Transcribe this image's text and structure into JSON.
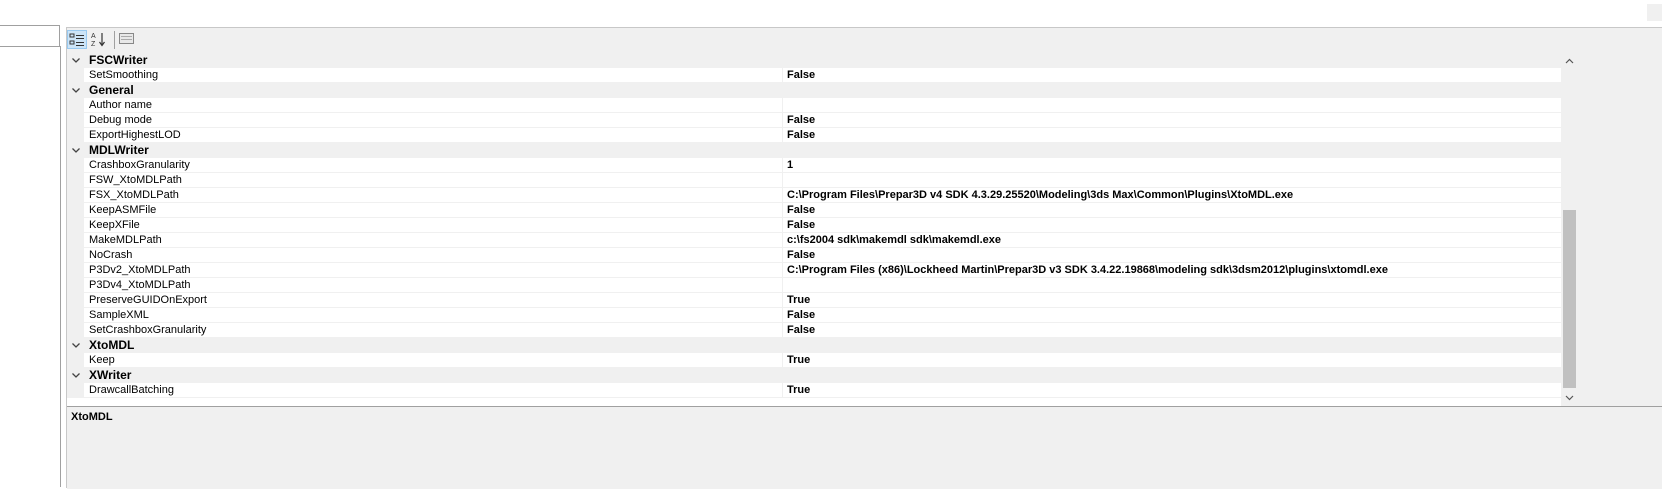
{
  "toolbar": {
    "categorized_tooltip": "Categorized",
    "alphabetical_tooltip": "Alphabetical",
    "property_pages_tooltip": "Property Pages"
  },
  "categories": [
    {
      "name": "FSCWriter",
      "properties": [
        {
          "name": "SetSmoothing",
          "value": "False"
        }
      ]
    },
    {
      "name": "General",
      "properties": [
        {
          "name": "Author name",
          "value": ""
        },
        {
          "name": "Debug mode",
          "value": "False"
        },
        {
          "name": "ExportHighestLOD",
          "value": "False"
        }
      ]
    },
    {
      "name": "MDLWriter",
      "properties": [
        {
          "name": "CrashboxGranularity",
          "value": "1"
        },
        {
          "name": "FSW_XtoMDLPath",
          "value": ""
        },
        {
          "name": "FSX_XtoMDLPath",
          "value": "C:\\Program Files\\Prepar3D v4 SDK 4.3.29.25520\\Modeling\\3ds Max\\Common\\Plugins\\XtoMDL.exe"
        },
        {
          "name": "KeepASMFile",
          "value": "False"
        },
        {
          "name": "KeepXFile",
          "value": "False"
        },
        {
          "name": "MakeMDLPath",
          "value": "c:\\fs2004 sdk\\makemdl sdk\\makemdl.exe"
        },
        {
          "name": "NoCrash",
          "value": "False"
        },
        {
          "name": "P3Dv2_XtoMDLPath",
          "value": "C:\\Program Files (x86)\\Lockheed Martin\\Prepar3D v3 SDK 3.4.22.19868\\modeling sdk\\3dsm2012\\plugins\\xtomdl.exe"
        },
        {
          "name": "P3Dv4_XtoMDLPath",
          "value": ""
        },
        {
          "name": "PreserveGUIDOnExport",
          "value": "True"
        },
        {
          "name": "SampleXML",
          "value": "False"
        },
        {
          "name": "SetCrashboxGranularity",
          "value": "False"
        }
      ]
    },
    {
      "name": "XtoMDL",
      "properties": [
        {
          "name": "Keep",
          "value": "True"
        }
      ]
    },
    {
      "name": "XWriter",
      "properties": [
        {
          "name": "DrawcallBatching",
          "value": "True"
        }
      ]
    }
  ],
  "description": {
    "title": "XtoMDL"
  },
  "colors": {
    "panel_bg": "#f0f0f0",
    "row_bg": "#ffffff",
    "toolbar_active": "#cce4f7",
    "scrollbar_thumb": "#c0c0c0"
  }
}
